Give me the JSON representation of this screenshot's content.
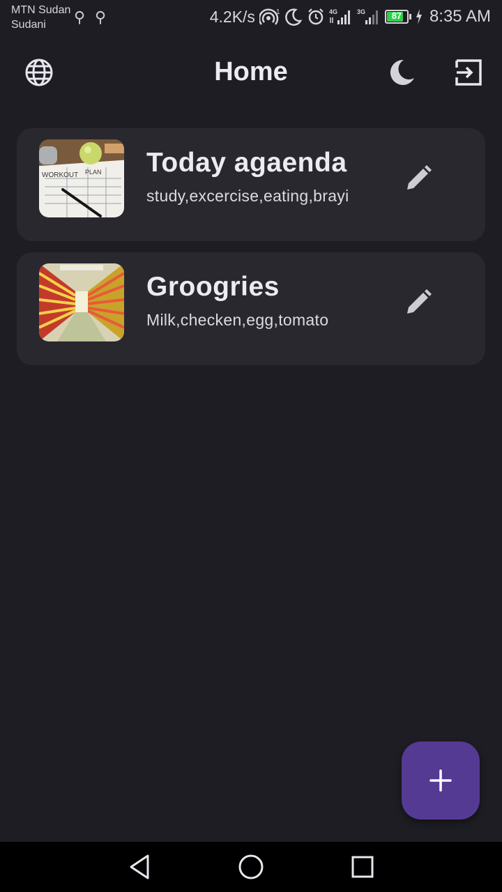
{
  "status_bar": {
    "carrier_line1": "MTN Sudan",
    "carrier_line2": "Sudani",
    "speed": "4.2K/s",
    "battery": "87",
    "time": "8:35 AM",
    "icons": [
      "usb-icon",
      "usb-icon",
      "hotspot-icon",
      "moon-icon",
      "alarm-icon",
      "signal-4g-icon",
      "signal-3g-icon",
      "battery-icon",
      "charging-icon"
    ]
  },
  "app_bar": {
    "title": "Home",
    "icons": [
      "globe-icon",
      "moon-icon",
      "logout-icon"
    ]
  },
  "notes": [
    {
      "title": "Today agaenda",
      "subtitle": "study,excercise,eating,brayi",
      "image": "workout-plan-photo"
    },
    {
      "title": "Groogries",
      "subtitle": "Milk,checken,egg,tomato",
      "image": "grocery-aisle-photo"
    }
  ],
  "fab": {
    "icon": "plus-icon"
  },
  "nav_bar": {
    "icons": [
      "back-icon",
      "home-icon",
      "recents-icon"
    ]
  },
  "colors": {
    "background": "#1e1d23",
    "card": "#29282f",
    "accent": "#543a93"
  }
}
